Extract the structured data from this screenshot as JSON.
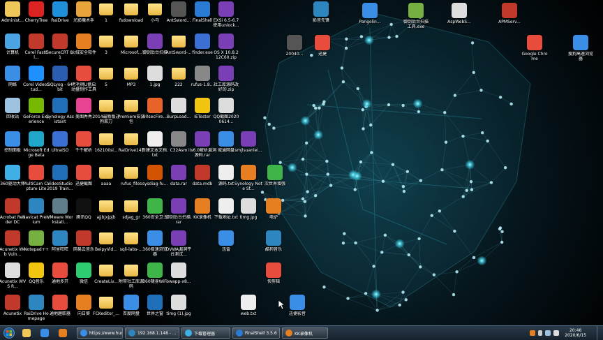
{
  "colors": {
    "folder": "#f0c85a",
    "accent": "#3fd0e6",
    "taskbar": "#1d2a36",
    "desktop": "#000000"
  },
  "icons": [
    {
      "id": "administrator",
      "label": "Administ...",
      "icon": "user-folder-icon",
      "color": "#f0c85a"
    },
    {
      "id": "cherrytree",
      "label": "CherryTree",
      "icon": "cherry-icon",
      "color": "#d22"
    },
    {
      "id": "raidrive",
      "label": "RaiDrive",
      "icon": "drive-icon",
      "color": "#1e8fd8"
    },
    {
      "id": "gb-magic",
      "label": "光影魔术手",
      "icon": "camera-icon",
      "color": "#e8a33a"
    },
    {
      "id": "f1",
      "label": "1",
      "icon": "folder-icon",
      "color": "#f0c85a"
    },
    {
      "id": "fsdownload",
      "label": "fsdownload",
      "icon": "folder-icon",
      "color": "#f0c85a"
    },
    {
      "id": "xiaoma",
      "label": "小马",
      "icon": "folder-icon",
      "color": "#f0c85a"
    },
    {
      "id": "antsword1",
      "label": "AntSword...",
      "icon": "antsword-icon",
      "color": "#555"
    },
    {
      "id": "finalshell",
      "label": "FinalShell",
      "icon": "terminal-icon",
      "color": "#2a7bd4"
    },
    {
      "id": "esxi",
      "label": "EXSi 6.5-6.7 使用unlock...",
      "icon": "archive-icon",
      "color": "#7a3fb5"
    },
    {
      "id": "computer",
      "label": "计算机",
      "icon": "computer-icon",
      "color": "#4ba3e3"
    },
    {
      "id": "corel-fastflick",
      "label": "Corel FastFl...",
      "icon": "corel-icon",
      "color": "#c0392b"
    },
    {
      "id": "securecrt",
      "label": "SecureCRT 8.1",
      "icon": "securecrt-icon",
      "color": "#c0392b"
    },
    {
      "id": "huorong",
      "label": "火绒安全软件",
      "icon": "shield-icon",
      "color": "#e67e22"
    },
    {
      "id": "f3",
      "label": "3",
      "icon": "folder-icon",
      "color": "#f0c85a"
    },
    {
      "id": "microsoft",
      "label": "Microsof...",
      "icon": "folder-icon",
      "color": "#f0c85a"
    },
    {
      "id": "ydhx",
      "label": "御剑后台扫描",
      "icon": "archive-icon",
      "color": "#7a3fb5"
    },
    {
      "id": "antsword2",
      "label": "AntSword-...",
      "icon": "folder-icon",
      "color": "#f0c85a"
    },
    {
      "id": "finder",
      "label": "finder.exe",
      "icon": "finder-icon",
      "color": "#3b6fd4"
    },
    {
      "id": "osx",
      "label": "OS X 10.8.2 12C60.zip",
      "icon": "archive-icon",
      "color": "#7a3fb5"
    },
    {
      "id": "network",
      "label": "网络",
      "icon": "network-icon",
      "color": "#3a8ee6"
    },
    {
      "id": "corel-videostudio",
      "label": "Corel VideoStud...",
      "icon": "video-icon",
      "color": "#1e90ff"
    },
    {
      "id": "sqlyog",
      "label": "SQLyog - 64 bit",
      "icon": "sqlyog-icon",
      "color": "#2a5db0"
    },
    {
      "id": "lzb-scan",
      "label": "老毛桃U盘启动盘制作工具",
      "icon": "usb-icon",
      "color": "#e84c3d"
    },
    {
      "id": "f5",
      "label": "5",
      "icon": "folder-icon",
      "color": "#f0c85a"
    },
    {
      "id": "mp3",
      "label": "MP3",
      "icon": "folder-icon",
      "color": "#f0c85a"
    },
    {
      "id": "jpg1",
      "label": "1.jpg",
      "icon": "image-icon",
      "color": "#ddd"
    },
    {
      "id": "f222",
      "label": "222",
      "icon": "folder-icon",
      "color": "#f0c85a"
    },
    {
      "id": "rufus",
      "label": "rufus-1.8...",
      "icon": "usb-icon",
      "color": "#888"
    },
    {
      "id": "dsgj",
      "label": "社工库源码改好的.zip",
      "icon": "archive-icon",
      "color": "#7a3fb5"
    },
    {
      "id": "recycle",
      "label": "回收站",
      "icon": "recycle-bin-icon",
      "color": "#9ec3e0"
    },
    {
      "id": "geforce",
      "label": "GeForce Experience",
      "icon": "nvidia-icon",
      "color": "#76b900"
    },
    {
      "id": "synology",
      "label": "Synology Assistant",
      "icon": "synology-icon",
      "color": "#1e6fb8"
    },
    {
      "id": "meitu",
      "label": "美图秀秀",
      "icon": "meitu-icon",
      "color": "#e84393"
    },
    {
      "id": "yn2014",
      "label": "2014最新版过狗菜刀",
      "icon": "folder-icon",
      "color": "#f0c85a"
    },
    {
      "id": "premiere",
      "label": "Premiere安装包",
      "icon": "folder-icon",
      "color": "#f0c85a"
    },
    {
      "id": "firefox90",
      "label": "90secFire...",
      "icon": "firefox-icon",
      "color": "#e8632a"
    },
    {
      "id": "burp",
      "label": "BurpLoad...",
      "icon": "document-icon",
      "color": "#ddd"
    },
    {
      "id": "ietester",
      "label": "IETester",
      "icon": "ietester-icon",
      "color": "#f1c40f"
    },
    {
      "id": "qqimg",
      "label": "QQ截图20200614...",
      "icon": "image-icon",
      "color": "#ddd"
    },
    {
      "id": "controlpanel",
      "label": "控制面板",
      "icon": "control-panel-icon",
      "color": "#3a8ee6"
    },
    {
      "id": "edge",
      "label": "Microsoft Edge Beta",
      "icon": "edge-icon",
      "color": "#1fa6c9"
    },
    {
      "id": "ultraiso",
      "label": "UltraISO",
      "icon": "disc-icon",
      "color": "#3a6fd4"
    },
    {
      "id": "qianqian",
      "label": "千千解析",
      "icon": "qianqian-icon",
      "color": "#e84c3d"
    },
    {
      "id": "f162100",
      "label": "162100si...",
      "icon": "folder-icon",
      "color": "#f0c85a"
    },
    {
      "id": "raidrive141",
      "label": "RaiDrive141",
      "icon": "folder-icon",
      "color": "#f0c85a"
    },
    {
      "id": "newtxt",
      "label": "新建文本文档.txt",
      "icon": "text-file-icon",
      "color": "#eee"
    },
    {
      "id": "c32asm",
      "label": "C32Asm",
      "icon": "c32asm-icon",
      "color": "#888"
    },
    {
      "id": "iis",
      "label": "iis6.0解析漏洞源码.rar",
      "icon": "archive-icon",
      "color": "#7a3fb5"
    },
    {
      "id": "cloud",
      "label": "城通网盘",
      "icon": "cloud-icon",
      "color": "#3a8ee6"
    },
    {
      "id": "speed360",
      "label": "360驱动大师",
      "icon": "speed-icon",
      "color": "#3fb0e6"
    },
    {
      "id": "multicam",
      "label": "MultiCam Capture Lite",
      "icon": "multicam-icon",
      "color": "#e84c3d"
    },
    {
      "id": "vs2019",
      "label": "VideoStudio 2019 Train...",
      "icon": "videostudio-icon",
      "color": "#1e6fb8"
    },
    {
      "id": "jietu",
      "label": "迅捷截图",
      "icon": "screenshot-icon",
      "color": "#e84c3d"
    },
    {
      "id": "aaaa",
      "label": "aaaa",
      "icon": "folder-icon",
      "color": "#f0c85a"
    },
    {
      "id": "rufusfiles",
      "label": "rufus_files",
      "icon": "folder-icon",
      "color": "#f0c85a"
    },
    {
      "id": "sysdiag",
      "label": "sysdiag-fu...",
      "icon": "setup-icon",
      "color": "#d35400"
    },
    {
      "id": "datarar",
      "label": "data.rar",
      "icon": "archive-icon",
      "color": "#7a3fb5"
    },
    {
      "id": "datamdb",
      "label": "data.mdb",
      "icon": "database-icon",
      "color": "#c0392b"
    },
    {
      "id": "yuanma",
      "label": "源码.txt",
      "icon": "text-file-icon",
      "color": "#eee"
    },
    {
      "id": "acrobat",
      "label": "Acrobat Reader DC",
      "icon": "pdf-icon",
      "color": "#c0392b"
    },
    {
      "id": "navicat",
      "label": "Navicat Premium",
      "icon": "navicat-icon",
      "color": "#2e86c1"
    },
    {
      "id": "vmware",
      "label": "VMware Workstati...",
      "icon": "vmware-icon",
      "color": "#607d8b"
    },
    {
      "id": "tencentqq",
      "label": "腾讯QQ",
      "icon": "qq-icon",
      "color": "#111"
    },
    {
      "id": "ajjpjb",
      "label": "ajjbjxjpjb",
      "icon": "folder-icon",
      "color": "#f0c85a"
    },
    {
      "id": "sdjag",
      "label": "sdjag_gr",
      "icon": "folder-icon",
      "color": "#f0c85a"
    },
    {
      "id": "safe360",
      "label": "360安全卫士",
      "icon": "safe360-icon",
      "color": "#3fb549"
    },
    {
      "id": "yjbk",
      "label": "御剑后台扫描.rar",
      "icon": "archive-icon",
      "color": "#7a3fb5"
    },
    {
      "id": "kk",
      "label": "KK录像机",
      "icon": "kk-recorder-icon",
      "color": "#e67e22"
    },
    {
      "id": "xiazai",
      "label": "下载地址.txt",
      "icon": "text-file-icon",
      "color": "#eee"
    },
    {
      "id": "acunetix1",
      "label": "Acunetix Web Vuln...",
      "icon": "acunetix-icon",
      "color": "#c0392b"
    },
    {
      "id": "notepadpp",
      "label": "Notepad++",
      "icon": "notepad-icon",
      "color": "#76b041"
    },
    {
      "id": "aliwangwang",
      "label": "阿里旺旺",
      "icon": "wangwang-icon",
      "color": "#2e86c1"
    },
    {
      "id": "neteasemusic",
      "label": "网易云音乐",
      "icon": "music-icon",
      "color": "#c0392b"
    },
    {
      "id": "beipyvid",
      "label": "BeipyVid...",
      "icon": "folder-icon",
      "color": "#f0c85a"
    },
    {
      "id": "sqlilabs",
      "label": "sqli-labs-...",
      "icon": "folder-icon",
      "color": "#f0c85a"
    },
    {
      "id": "browser360",
      "label": "360极速浏览器",
      "icon": "browser360-icon",
      "color": "#3a8ee6"
    },
    {
      "id": "dvwa",
      "label": "DVWA漏洞平台测试...",
      "icon": "archive-icon",
      "color": "#7a3fb5"
    },
    {
      "id": "acunetix2",
      "label": "Acunetix WVS R...",
      "icon": "document-icon",
      "color": "#ddd"
    },
    {
      "id": "qqmusic",
      "label": "QQ音乐",
      "icon": "qqmusic-icon",
      "color": "#f1c40f"
    },
    {
      "id": "tongnian",
      "label": "通地多开",
      "icon": "multi-icon",
      "color": "#e84c3d"
    },
    {
      "id": "wechat",
      "label": "微信",
      "icon": "wechat-icon",
      "color": "#2ecc71"
    },
    {
      "id": "createliv",
      "label": "CreateLiv...",
      "icon": "folder-icon",
      "color": "#f0c85a"
    },
    {
      "id": "fjsgk",
      "label": "附带社工库源码",
      "icon": "folder-icon",
      "color": "#f0c85a"
    },
    {
      "id": "wifi360",
      "label": "360随身WiFi",
      "icon": "wifi-icon",
      "color": "#3fb549"
    },
    {
      "id": "owapp",
      "label": "owapp-x8...",
      "icon": "document-icon",
      "color": "#ddd"
    },
    {
      "id": "acunetix3",
      "label": "Acunetix",
      "icon": "acunetix-icon",
      "color": "#c0392b"
    },
    {
      "id": "raidrive-home",
      "label": "RaiDrive Homepage",
      "icon": "raidrive-icon",
      "color": "#2e86c1"
    },
    {
      "id": "tongnian2",
      "label": "通地趣职器",
      "icon": "multi-icon",
      "color": "#e84c3d"
    },
    {
      "id": "xiangrike",
      "label": "向日葵",
      "icon": "sunflower-icon",
      "color": "#e67e22"
    },
    {
      "id": "fckeditor",
      "label": "FCKeditor_...",
      "icon": "folder-icon",
      "color": "#f0c85a"
    },
    {
      "id": "baiduyun",
      "label": "百度网盘",
      "icon": "baidu-cloud-icon",
      "color": "#3a8ee6"
    },
    {
      "id": "world",
      "label": "世界之窗",
      "icon": "world-browser-icon",
      "color": "#1e6fb8"
    },
    {
      "id": "timg1",
      "label": "timg (1).jpg",
      "icon": "image-icon",
      "color": "#ddd"
    },
    {
      "id": "yingyin",
      "label": "影音先锋",
      "icon": "player-icon",
      "color": "#2e86c1"
    },
    {
      "id": "pangolin",
      "label": "Pangolin...",
      "icon": "pangolin-icon",
      "color": "#3a8ee6"
    },
    {
      "id": "yjsc",
      "label": "御剑后台扫描工具.exe",
      "icon": "arrow-exe-icon",
      "color": "#76b041"
    },
    {
      "id": "aspwebserver",
      "label": "AspWebS...",
      "icon": "server-icon",
      "color": "#ddd"
    },
    {
      "id": "apmserv",
      "label": "APMServ...",
      "icon": "apm-icon",
      "color": "#c0392b"
    },
    {
      "id": "chrome",
      "label": "Google Chrome",
      "icon": "chrome-icon",
      "color": "#e84c3d"
    },
    {
      "id": "sougou",
      "label": "搜狗高速浏览器",
      "icon": "sogou-icon",
      "color": "#3a8ee6"
    },
    {
      "id": "img2004",
      "label": "20040...",
      "icon": "image-icon",
      "color": "#555"
    },
    {
      "id": "jiequ",
      "label": "迅捷",
      "icon": "jiequ-icon",
      "color": "#e84c3d"
    },
    {
      "id": "smjian",
      "label": "smjlsuanlei...",
      "icon": "archive-icon",
      "color": "#7a3fb5"
    },
    {
      "id": "synology-note",
      "label": "Synology Note St...",
      "icon": "synology-note-icon",
      "color": "#e67e22"
    },
    {
      "id": "cjwm",
      "label": "次世界增强",
      "icon": "plant-icon",
      "color": "#3fb549"
    },
    {
      "id": "timgjpg",
      "label": "timg.jpg",
      "icon": "image-icon",
      "color": "#ddd"
    },
    {
      "id": "diandian",
      "label": "电驴",
      "icon": "emule-icon",
      "color": "#e67e22"
    },
    {
      "id": "xunlei",
      "label": "迅雷",
      "icon": "xunlei-icon",
      "color": "#3a8ee6"
    },
    {
      "id": "kuku",
      "label": "酷狗音乐",
      "icon": "kugou-icon",
      "color": "#2e86c1"
    },
    {
      "id": "kuaijian",
      "label": "快剪辑",
      "icon": "kuaijian-icon",
      "color": "#e84c3d"
    },
    {
      "id": "webtxt",
      "label": "web.txt",
      "icon": "text-file-icon",
      "color": "#eee"
    },
    {
      "id": "xunjie-shadow",
      "label": "迅捷影音",
      "icon": "xunjie-icon",
      "color": "#3a8ee6"
    }
  ],
  "taskbar": {
    "pins": [
      {
        "name": "explorer-icon",
        "color": "#f0c85a"
      },
      {
        "name": "ie-icon",
        "color": "#3a8ee6"
      },
      {
        "name": "media-player-icon",
        "color": "#e67e22"
      }
    ],
    "tasks": [
      {
        "label": "https://www.huo...",
        "icon": "browser-task-icon",
        "color": "#3a8ee6"
      },
      {
        "label": "192.168.1.148 - ...",
        "icon": "remote-task-icon",
        "color": "#2e86c1"
      },
      {
        "label": "下载管理器",
        "icon": "download-task-icon",
        "color": "#3fb0e6"
      },
      {
        "label": "FinalShell 3.5.6",
        "icon": "finalshell-task-icon",
        "color": "#2a7bd4"
      },
      {
        "label": "KK录像机",
        "icon": "kk-task-icon",
        "color": "#e67e22"
      }
    ],
    "time": "20:46",
    "date": "2020/6/15"
  }
}
